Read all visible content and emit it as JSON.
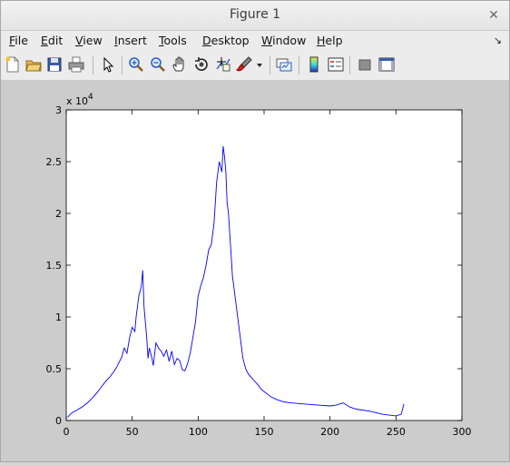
{
  "window": {
    "title": "Figure 1",
    "close_glyph": "✕"
  },
  "menu": [
    {
      "label": "File",
      "underline": "F",
      "rest": "ile"
    },
    {
      "label": "Edit",
      "underline": "E",
      "rest": "dit"
    },
    {
      "label": "View",
      "underline": "V",
      "rest": "iew"
    },
    {
      "label": "Insert",
      "underline": "I",
      "rest": "nsert"
    },
    {
      "label": "Tools",
      "underline": "T",
      "rest": "ools"
    },
    {
      "label": "Desktop",
      "underline": "D",
      "rest": "esktop"
    },
    {
      "label": "Window",
      "underline": "W",
      "rest": "indow"
    },
    {
      "label": "Help",
      "underline": "H",
      "rest": "elp"
    }
  ],
  "toolbar_icons": [
    "new-figure-icon",
    "open-file-icon",
    "save-icon",
    "print-icon",
    "pointer-icon",
    "zoom-in-icon",
    "zoom-out-icon",
    "pan-hand-icon",
    "rotate-3d-icon",
    "data-cursor-icon",
    "brush-icon",
    "brush-dropdown-icon",
    "link-plot-icon",
    "colorbar-icon",
    "legend-icon",
    "hide-plot-tools-icon",
    "show-plot-tools-icon"
  ],
  "chart_data": {
    "type": "line",
    "title": "",
    "xlabel": "",
    "ylabel": "",
    "xlim": [
      0,
      300
    ],
    "ylim": [
      0,
      30000
    ],
    "x_ticks": [
      "0",
      "50",
      "100",
      "150",
      "200",
      "250",
      "300"
    ],
    "y_ticks": [
      "0",
      "0.5",
      "1",
      "1.5",
      "2",
      "2.5",
      "3"
    ],
    "y_multiplier": "x 10",
    "y_multiplier_exp": "4",
    "line_color": "#0000ff",
    "grid": false,
    "series": [
      {
        "x": [
          1,
          3,
          5,
          8,
          12,
          16,
          20,
          24,
          27,
          30,
          33,
          36,
          38,
          40,
          42,
          44,
          46,
          48,
          50,
          52,
          53,
          54,
          55,
          56,
          57,
          58,
          59,
          60,
          61,
          62,
          63,
          64,
          65,
          66,
          68,
          70,
          72,
          74,
          76,
          78,
          80,
          82,
          84,
          86,
          88,
          90,
          92,
          94,
          96,
          98,
          100,
          102,
          104,
          106,
          108,
          110,
          112,
          114,
          116,
          118,
          119,
          120,
          121,
          122,
          123,
          124,
          125,
          126,
          128,
          130,
          132,
          134,
          136,
          138,
          140,
          142,
          145,
          148,
          150,
          155,
          160,
          165,
          170,
          180,
          190,
          200,
          205,
          210,
          215,
          220,
          230,
          240,
          250,
          254,
          256
        ],
        "y": [
          300,
          600,
          800,
          1000,
          1300,
          1700,
          2200,
          2800,
          3300,
          3800,
          4200,
          4700,
          5100,
          5600,
          6100,
          7000,
          6500,
          8000,
          9000,
          8600,
          10000,
          11000,
          12000,
          12500,
          13000,
          14500,
          11000,
          9500,
          8000,
          6000,
          7000,
          6500,
          6000,
          5300,
          7500,
          7000,
          6700,
          6200,
          6800,
          5700,
          6700,
          5400,
          6000,
          5800,
          4900,
          4800,
          5500,
          6500,
          8000,
          9500,
          12000,
          13000,
          13800,
          15000,
          16500,
          17000,
          19000,
          23000,
          25000,
          24000,
          26500,
          25500,
          24000,
          21000,
          20000,
          18000,
          16000,
          14000,
          12000,
          10000,
          8000,
          6000,
          5000,
          4500,
          4200,
          3900,
          3500,
          3000,
          2800,
          2300,
          2000,
          1800,
          1700,
          1600,
          1500,
          1400,
          1500,
          1700,
          1300,
          1100,
          900,
          600,
          450,
          600,
          1600
        ]
      }
    ]
  }
}
